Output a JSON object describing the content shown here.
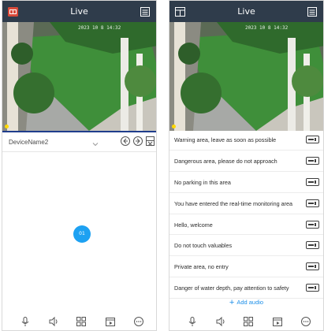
{
  "left_screen": {
    "title": "Live",
    "osd_text": "2023 10 8 14:32",
    "device_name": "DeviceName2",
    "channel_label": "01",
    "bottom_icons": [
      "microphone-icon",
      "speaker-icon",
      "grid-icon",
      "playback-icon",
      "more-icon"
    ]
  },
  "right_screen": {
    "title": "Live",
    "osd_text": "2023 10 8 14:32",
    "audio_items": [
      "Warning area, leave as soon as possible",
      "Dangerous area, please do not approach",
      "No parking in this area",
      "You have entered the real-time monitoring area",
      "Hello, welcome",
      "Do not touch valuables",
      "Private area, no entry",
      "Danger of water depth, pay attention to safety"
    ],
    "add_audio_label": "Add audio",
    "bottom_icons": [
      "microphone-icon",
      "speaker-icon",
      "grid-icon",
      "playback-icon",
      "more-icon"
    ]
  },
  "colors": {
    "topbar": "#2f3c4b",
    "accent_blue": "#1da1f2",
    "add_audio_blue": "#1d8fe8",
    "live_indicator": "#ffd800"
  }
}
